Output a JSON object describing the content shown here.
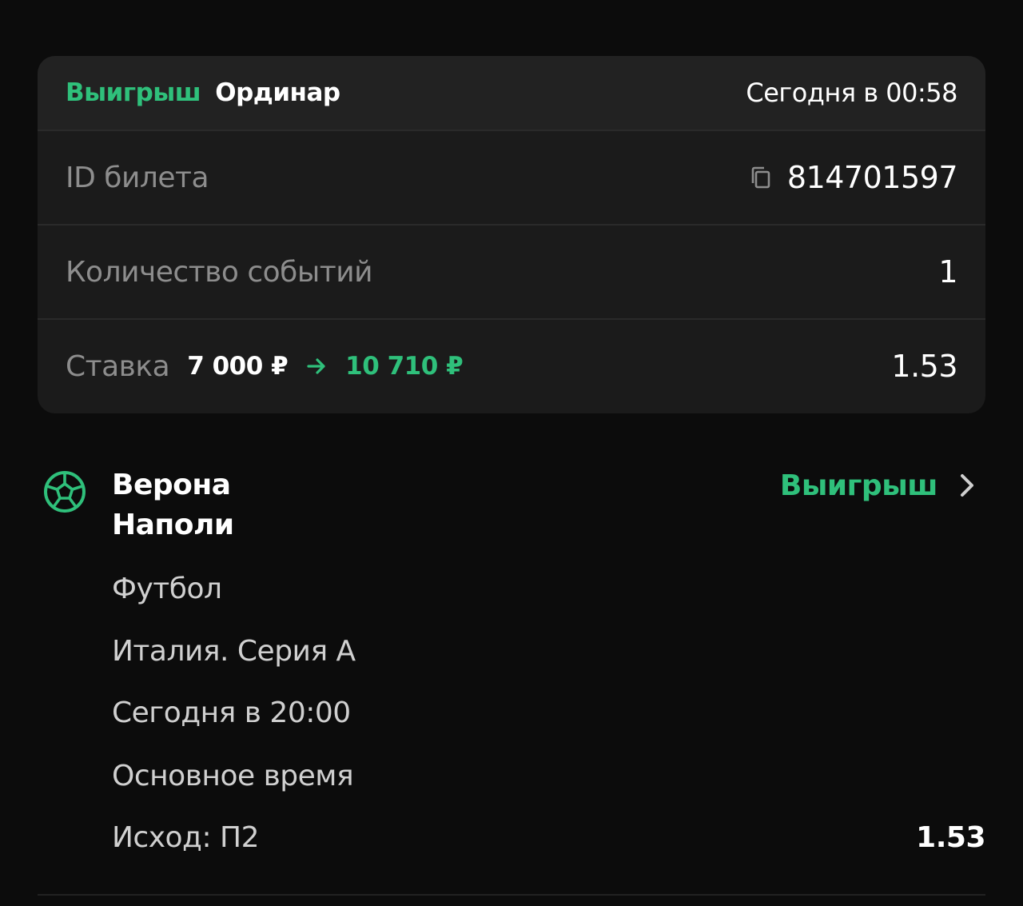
{
  "ticket": {
    "status": "Выигрыш",
    "bet_type": "Ординар",
    "placed_time": "Сегодня в 00:58",
    "id_label": "ID билета",
    "id_value": "814701597",
    "events_label": "Количество событий",
    "events_value": "1",
    "stake_label": "Ставка",
    "stake_amount": "7 000 ₽",
    "payout_amount": "10 710 ₽",
    "total_odds": "1.53"
  },
  "event": {
    "home_team": "Верона",
    "away_team": "Наполи",
    "status": "Выигрыш",
    "sport": "Футбол",
    "league": "Италия. Серия A",
    "start_time": "Сегодня в 20:00",
    "period": "Основное время",
    "outcome": "Исход: П2",
    "odds": "1.53"
  },
  "colors": {
    "accent_green": "#2fc07b",
    "background": "#0c0c0c",
    "card": "#1b1b1b",
    "card_header": "#222222"
  },
  "icons": {
    "copy": "copy-icon",
    "arrow": "arrow-right-icon",
    "sport": "soccer-ball-icon",
    "chevron": "chevron-right-icon"
  }
}
